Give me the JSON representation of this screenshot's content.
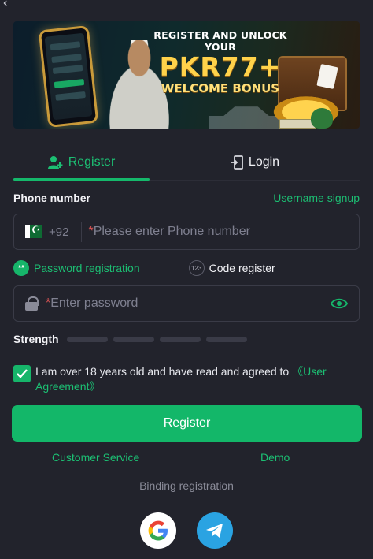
{
  "nav": {
    "back_glyph": "‹"
  },
  "banner": {
    "line1": "REGISTER AND UNLOCK YOUR",
    "line2": "PKR77+",
    "line3": "WELCOME BONUS"
  },
  "tabs": [
    {
      "label": "Register",
      "icon": "user-plus-icon",
      "active": true
    },
    {
      "label": "Login",
      "icon": "login-door-icon",
      "active": false
    }
  ],
  "phone": {
    "label": "Phone number",
    "alt_link": "Username signup",
    "country_code": "+92",
    "required_mark": "*",
    "placeholder": "Please enter Phone number",
    "flag": "pakistan-flag-icon"
  },
  "modes": [
    {
      "label": "Password registration",
      "icon_text": "**",
      "active": true
    },
    {
      "label": "Code register",
      "icon_text": "123",
      "active": false
    }
  ],
  "password": {
    "required_mark": "*",
    "placeholder": "Enter password",
    "visibility_icon": "eye-icon"
  },
  "strength": {
    "label": "Strength",
    "level": 0,
    "segments": 4
  },
  "agreement": {
    "checked": true,
    "text": "I am over 18 years old and have read and agreed to ",
    "link": "《User Agreement》"
  },
  "register_button": "Register",
  "footer_links": {
    "customer_service": "Customer Service",
    "demo": "Demo"
  },
  "binding": {
    "label": "Binding registration"
  },
  "social": [
    {
      "name": "google",
      "icon": "google-icon"
    },
    {
      "name": "telegram",
      "icon": "telegram-icon"
    }
  ],
  "colors": {
    "background": "#22232c",
    "accent": "#16b56a",
    "input_border": "#3a3b47",
    "placeholder": "#7f8090"
  }
}
